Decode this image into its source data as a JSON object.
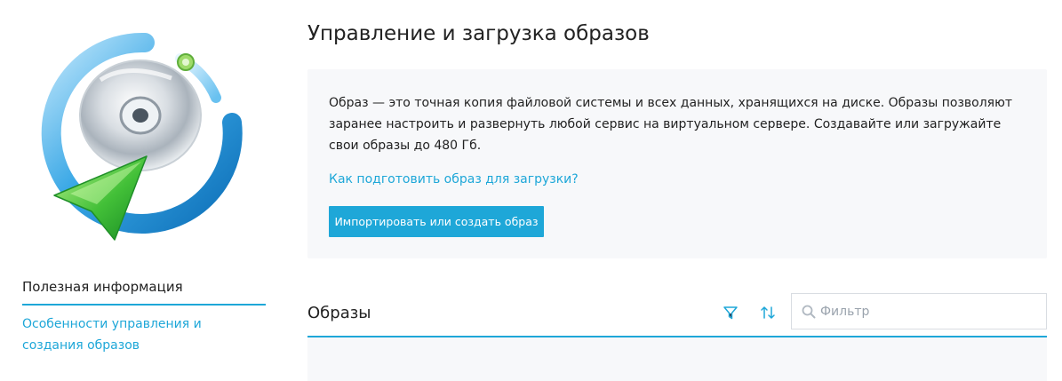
{
  "page": {
    "title": "Управление и загрузка образов"
  },
  "hero": {
    "icon": "disc-upload-icon"
  },
  "info": {
    "description": "Образ — это точная копия файловой системы и всех данных, хранящихся на диске. Образы позволяют заранее настроить и развернуть любой сервис на виртуальном сервере. Создавайте или загружайте свои образы до 480 Гб.",
    "prepare_link": "Как подготовить образ для загрузки?",
    "import_button": "Импортировать или создать образ"
  },
  "sidebar": {
    "heading": "Полезная информация",
    "links": [
      "Особенности управления и создания образов"
    ]
  },
  "images_section": {
    "title": "Образы",
    "filter_placeholder": "Фильтр",
    "filter_value": "",
    "icons": {
      "filter": "funnel-icon",
      "sort": "sort-arrows-icon",
      "search": "search-icon"
    }
  },
  "colors": {
    "accent": "#1ea7d8",
    "panel_bg": "#f7f8fa",
    "text": "#222222"
  }
}
